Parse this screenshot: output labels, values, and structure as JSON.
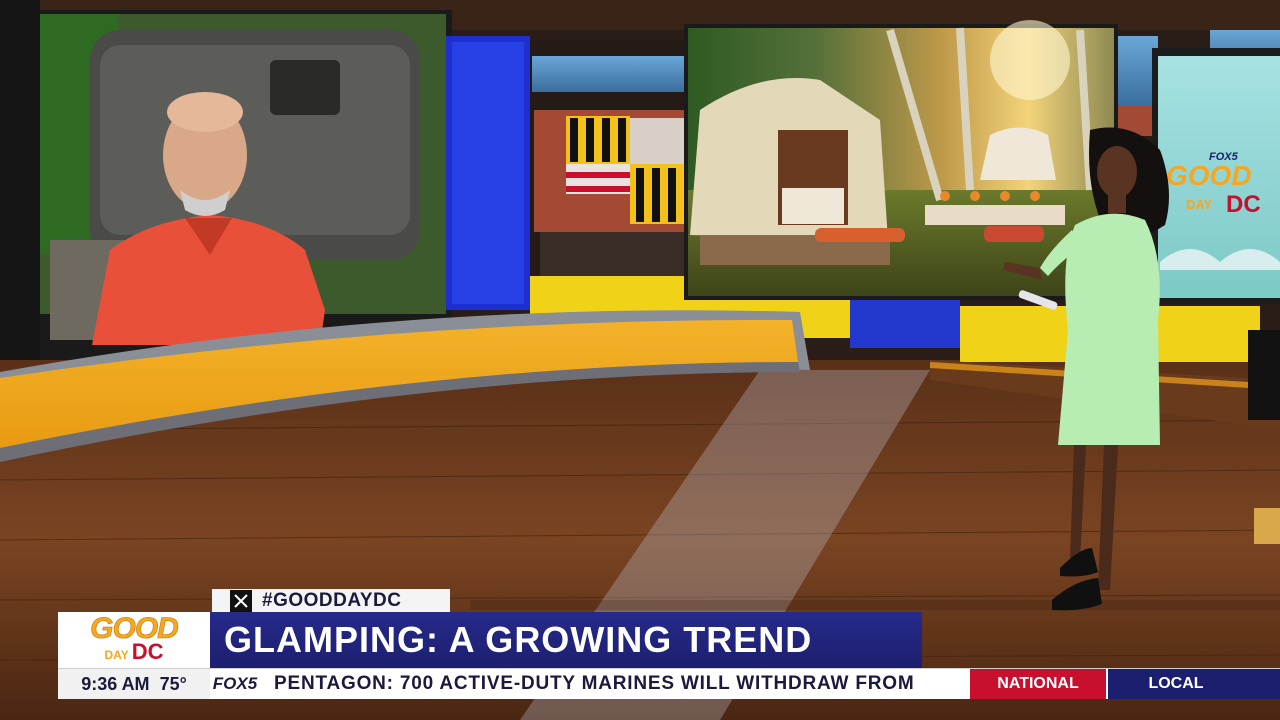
{
  "lower_third": {
    "hashtag": "#GOODDAYDC",
    "logo": {
      "good": "GOOD",
      "day": "DAY",
      "dc": "DC"
    },
    "headline": "GLAMPING: A GROWING TREND"
  },
  "ticker": {
    "time": "9:36 AM",
    "temperature": "75°",
    "station": "FOX5",
    "text": "PENTAGON: 700 ACTIVE-DUTY MARINES WILL WITHDRAW FROM",
    "tabs": [
      "NATIONAL",
      "LOCAL"
    ]
  },
  "studio_screen": {
    "brand_small": "FOX5",
    "brand_good": "GOOD",
    "brand_day": "DAY",
    "brand_dc": "DC"
  },
  "colors": {
    "brand_blue": "#1c1f6e",
    "brand_red": "#c8102e",
    "brand_orange": "#f5a623",
    "studio_yellow": "#f2d21b"
  }
}
